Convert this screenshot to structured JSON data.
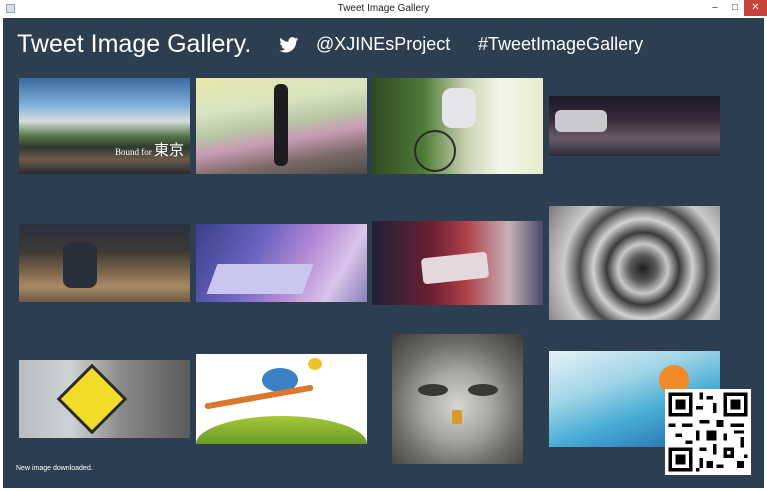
{
  "window": {
    "title": "Tweet Image Gallery",
    "minimize_label": "–",
    "maximize_label": "□",
    "close_label": "✕"
  },
  "header": {
    "title": "Tweet Image Gallery.",
    "account": "@XJINEsProject",
    "hashtag": "#TweetImageGallery",
    "icon": "twitter-bird-icon"
  },
  "gallery": {
    "images": [
      {
        "name": "bound-for-tokyo-street",
        "caption_small": "Bound for ",
        "caption_big": "東京"
      },
      {
        "name": "woman-walking-road"
      },
      {
        "name": "cyclist-with-helmet"
      },
      {
        "name": "night-street-cars"
      },
      {
        "name": "sneakers-on-gravel"
      },
      {
        "name": "keyboard-and-mouse"
      },
      {
        "name": "hands-holding-smartphone"
      },
      {
        "name": "spiral-staircase"
      },
      {
        "name": "pedestrian-crossing-sign"
      },
      {
        "name": "bird-on-branch-illustration"
      },
      {
        "name": "owl-face"
      },
      {
        "name": "drink-glass"
      }
    ]
  },
  "status": {
    "message": "New image downloaded."
  },
  "colors": {
    "background": "#2c3e50",
    "close_button": "#c7443a"
  }
}
